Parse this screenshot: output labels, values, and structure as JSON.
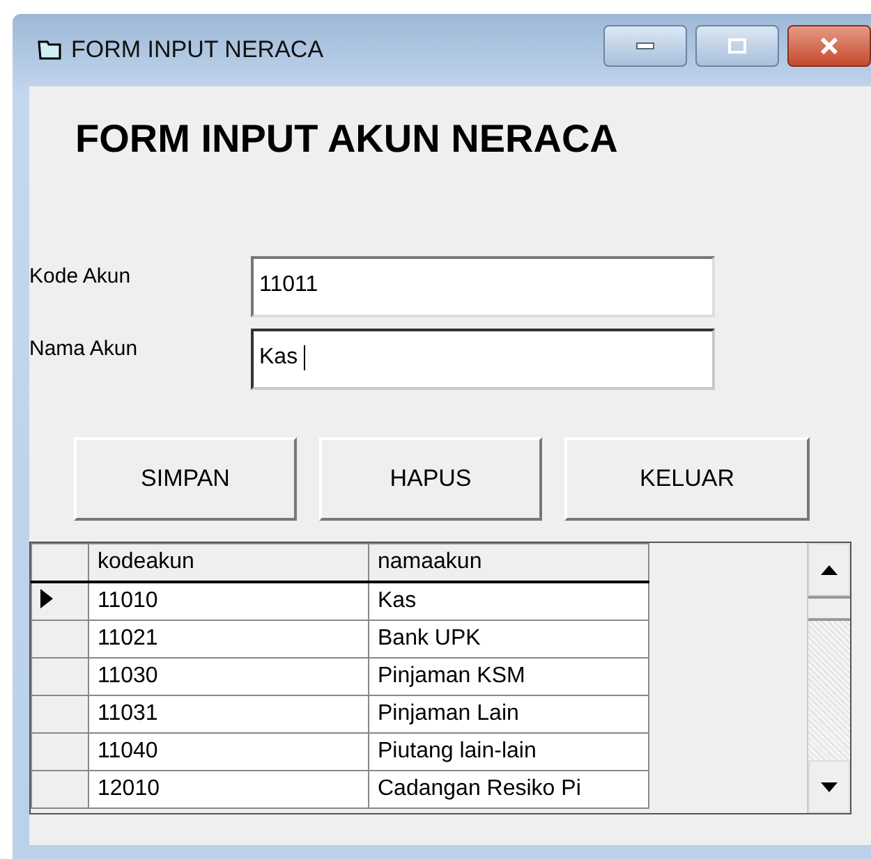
{
  "window": {
    "title": "FORM INPUT NERACA"
  },
  "heading": "FORM INPUT AKUN NERACA",
  "fields": [
    {
      "label": "Kode Akun",
      "value": "11011",
      "focused": false
    },
    {
      "label": "Nama Akun",
      "value": "Kas",
      "focused": true
    }
  ],
  "buttons": [
    "SIMPAN",
    "HAPUS",
    "KELUAR"
  ],
  "table": {
    "columns": [
      "kodeakun",
      "namaakun"
    ],
    "rows": [
      {
        "cells": [
          "11010",
          "Kas"
        ],
        "selected": true
      },
      {
        "cells": [
          "11021",
          "Bank UPK"
        ],
        "selected": false
      },
      {
        "cells": [
          "11030",
          "Pinjaman KSM"
        ],
        "selected": false
      },
      {
        "cells": [
          "11031",
          "Pinjaman Lain"
        ],
        "selected": false
      },
      {
        "cells": [
          "11040",
          "Piutang lain-lain"
        ],
        "selected": false
      },
      {
        "cells": [
          "12010",
          "Cadangan Resiko Pi"
        ],
        "selected": false
      }
    ]
  }
}
